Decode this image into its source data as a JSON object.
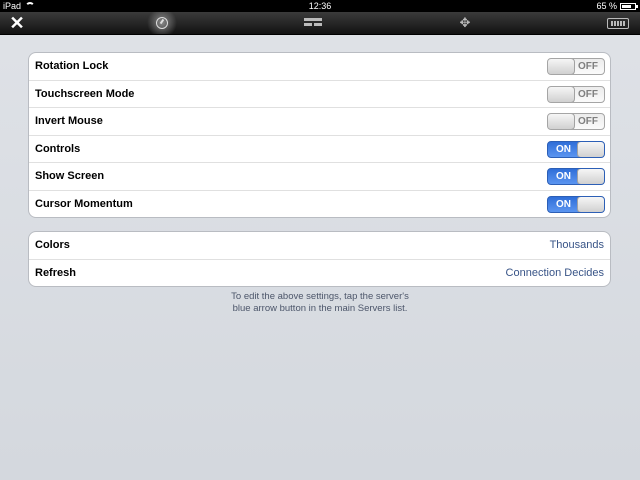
{
  "status_bar": {
    "device": "iPad",
    "time": "12:36",
    "battery": "65 %"
  },
  "toolbar": {
    "close_glyph": "✕",
    "icons": [
      "close-icon",
      "settings-gauge-icon",
      "screens-icon",
      "move-arrows-icon",
      "keyboard-icon"
    ]
  },
  "settings": [
    {
      "label": "Rotation Lock",
      "state": "OFF"
    },
    {
      "label": "Touchscreen Mode",
      "state": "OFF"
    },
    {
      "label": "Invert Mouse",
      "state": "OFF"
    },
    {
      "label": "Controls",
      "state": "ON"
    },
    {
      "label": "Show Screen",
      "state": "ON"
    },
    {
      "label": "Cursor Momentum",
      "state": "ON"
    }
  ],
  "display": [
    {
      "label": "Colors",
      "value": "Thousands"
    },
    {
      "label": "Refresh",
      "value": "Connection Decides"
    }
  ],
  "footnote": {
    "line1": "To edit the above settings, tap the server's",
    "line2": "blue arrow button in the main Servers list."
  },
  "colors": {
    "toggle_on": "#3d7fe6",
    "value_text": "#385487"
  }
}
